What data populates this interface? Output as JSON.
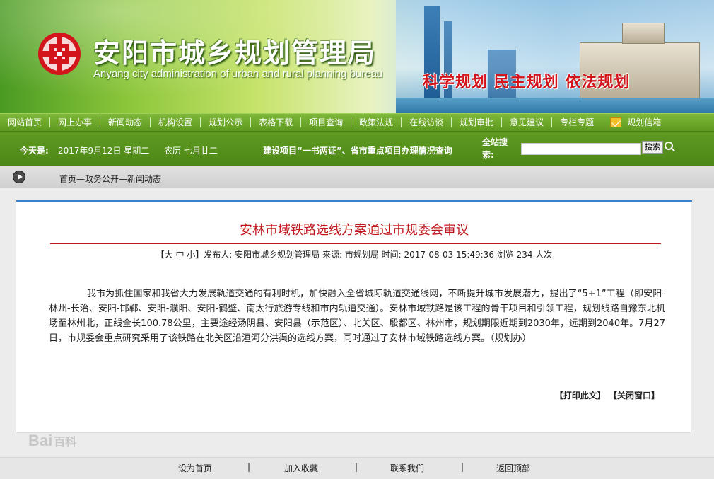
{
  "header": {
    "title": "安阳市城乡规划管理局",
    "subtitle": "Anyang city administration of urban and rural planning bureau",
    "slogan": "科学规划  民主规划  依法规划"
  },
  "nav": {
    "items": [
      "网站首页",
      "网上办事",
      "新闻动态",
      "机构设置",
      "规划公示",
      "表格下载",
      "项目查询",
      "政策法规",
      "在线访谈",
      "规划审批",
      "意见建议",
      "专栏专题"
    ],
    "mail_label": "规划信箱"
  },
  "info": {
    "date_label": "今天是:",
    "date": "2017年9月12日 星期二",
    "lunar": "农历 七月廿二",
    "promo": "建设项目“一书两证”、省市重点项目办理情况查询",
    "search_label": "全站搜索:",
    "search_button": "搜索",
    "search_value": ""
  },
  "breadcrumb": "首页—政务公开—新闻动态",
  "article": {
    "title": "安林市域铁路选线方案通过市规委会审议",
    "meta": "【大 中 小】发布人: 安阳市城乡规划管理局     来源:  市规划局      时间: 2017-08-03 15:49:36     浏览 234 人次",
    "body": "我市为抓住国家和我省大力发展轨道交通的有利时机，加快融入全省城际轨道交通线网，不断提升城市发展潜力，提出了“5+1”工程（即安阳-林州-长治、安阳-邯郸、安阳-濮阳、安阳-鹤壁、南太行旅游专线和市内轨道交通）。安林市域铁路是该工程的骨干项目和引领工程，规划线路自豫东北机场至林州北，正线全长100.78公里，主要途经汤阴县、安阳县（示范区）、北关区、殷都区、林州市，规划期限近期到2030年，远期到2040年。7月27日，市规委会重点研究采用了该铁路在北关区沿洹河分洪渠的选线方案，同时通过了安林市域铁路选线方案。（规划办）",
    "print_label": "【打印此文】",
    "close_label": "【关闭窗口】"
  },
  "watermark": {
    "brand": "Bai",
    "cn": "百科"
  },
  "footer": {
    "links": [
      "设为首页",
      "加入收藏",
      "联系我们",
      "返回顶部"
    ],
    "separator": "|"
  },
  "colors": {
    "nav_green": "#6fa82b",
    "title_red": "#c0171d",
    "slogan_red": "#d2141b",
    "topline_blue": "#3d7fd1"
  }
}
